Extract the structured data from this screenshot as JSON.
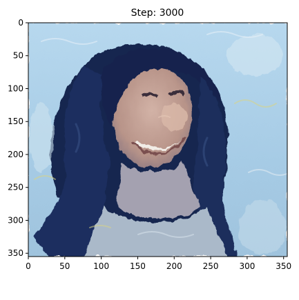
{
  "chart_data": {
    "type": "image",
    "title": "Step: 3000",
    "xlim": [
      0,
      355
    ],
    "ylim": [
      355,
      0
    ],
    "x_ticks": [
      0,
      50,
      100,
      150,
      200,
      250,
      300,
      350
    ],
    "y_ticks": [
      0,
      50,
      100,
      150,
      200,
      250,
      300,
      350
    ],
    "xlabel": "",
    "ylabel": "",
    "grid": false,
    "image_content": "stylized portrait of a smiling woman with long dark hair, painted in a swirled brush-stroke style",
    "palette": {
      "sky": "#a9cfe8",
      "sky_light": "#cfe4f1",
      "hair": "#13244e",
      "hair_mid": "#2a3f6e",
      "skin": "#c8a59a",
      "skin_shadow": "#9c7f7a",
      "teeth": "#f1ece6",
      "accent_yellow": "#d8d487"
    }
  }
}
